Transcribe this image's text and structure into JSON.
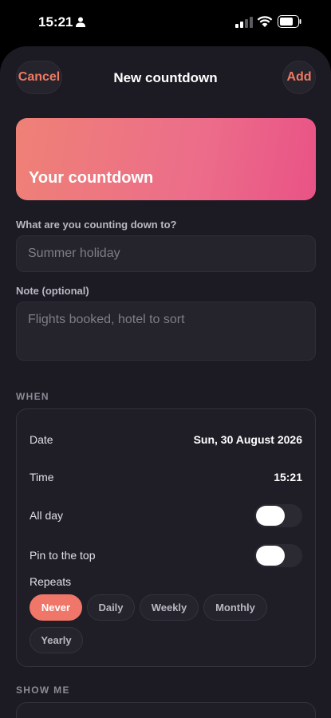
{
  "status_bar": {
    "time": "15:21"
  },
  "nav": {
    "cancel": "Cancel",
    "title": "New countdown",
    "add": "Add"
  },
  "preview": {
    "title": "Your countdown"
  },
  "form": {
    "title_label": "What are you counting down to?",
    "title_placeholder": "Summer holiday",
    "note_label": "Note (optional)",
    "note_placeholder": "Flights booked, hotel to sort"
  },
  "when": {
    "header": "WHEN",
    "date_label": "Date",
    "date_value": "Sun, 30 August 2026",
    "time_label": "Time",
    "time_value": "15:21",
    "all_day_label": "All day",
    "all_day_on": false,
    "pin_label": "Pin to the top",
    "pin_on": false,
    "repeats_label": "Repeats",
    "repeat_options": [
      "Never",
      "Daily",
      "Weekly",
      "Monthly",
      "Yearly"
    ],
    "repeat_selected": "Never"
  },
  "show_me": {
    "header": "SHOW ME"
  },
  "colors": {
    "accent": "#ef7668",
    "background": "#1c1b24",
    "gradient_start": "#ef8176",
    "gradient_end": "#e95386"
  }
}
